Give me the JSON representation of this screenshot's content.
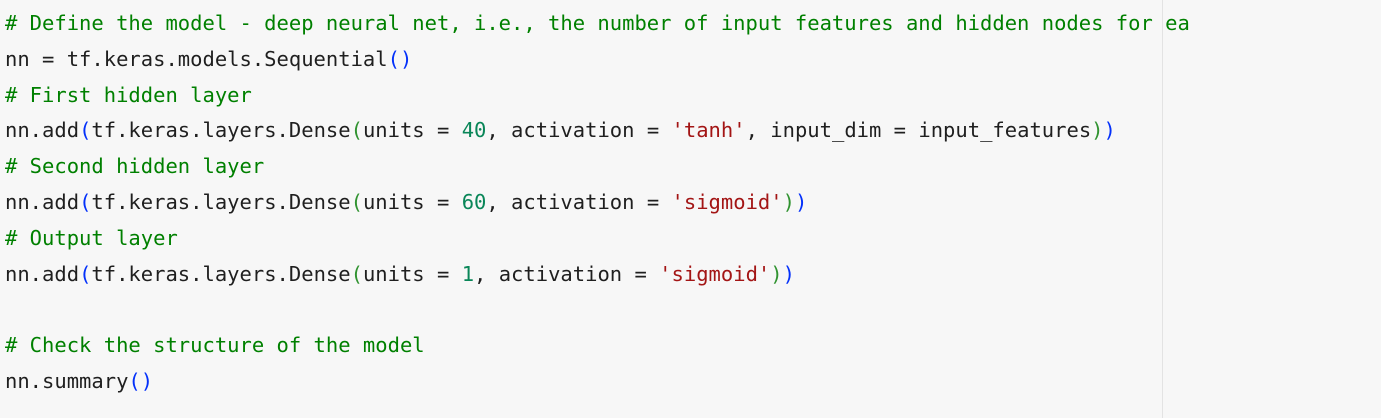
{
  "editor": {
    "language": "python",
    "colors": {
      "background": "#f7f7f7",
      "text": "#1f1f1f",
      "comment": "#008000",
      "number": "#098658",
      "string": "#a31515",
      "bracket_level_1": "#0431fa",
      "bracket_level_2": "#319331"
    },
    "lines": [
      [
        {
          "t": "# Define the model - deep neural net, i.e., the number of input features and hidden nodes for ea",
          "c": "comment"
        }
      ],
      [
        {
          "t": "nn = tf.keras.models.Sequential",
          "c": "plain"
        },
        {
          "t": "()",
          "c": "p1"
        }
      ],
      [
        {
          "t": "# First hidden layer",
          "c": "comment"
        }
      ],
      [
        {
          "t": "nn.add",
          "c": "plain"
        },
        {
          "t": "(",
          "c": "p1"
        },
        {
          "t": "tf.keras.layers.Dense",
          "c": "plain"
        },
        {
          "t": "(",
          "c": "p2"
        },
        {
          "t": "units = ",
          "c": "plain"
        },
        {
          "t": "40",
          "c": "num"
        },
        {
          "t": ", activation = ",
          "c": "plain"
        },
        {
          "t": "'tanh'",
          "c": "str"
        },
        {
          "t": ", input_dim = input_features",
          "c": "plain"
        },
        {
          "t": ")",
          "c": "p2"
        },
        {
          "t": ")",
          "c": "p1"
        }
      ],
      [
        {
          "t": "# Second hidden layer",
          "c": "comment"
        }
      ],
      [
        {
          "t": "nn.add",
          "c": "plain"
        },
        {
          "t": "(",
          "c": "p1"
        },
        {
          "t": "tf.keras.layers.Dense",
          "c": "plain"
        },
        {
          "t": "(",
          "c": "p2"
        },
        {
          "t": "units = ",
          "c": "plain"
        },
        {
          "t": "60",
          "c": "num"
        },
        {
          "t": ", activation = ",
          "c": "plain"
        },
        {
          "t": "'sigmoid'",
          "c": "str"
        },
        {
          "t": ")",
          "c": "p2"
        },
        {
          "t": ")",
          "c": "p1"
        }
      ],
      [
        {
          "t": "# Output layer",
          "c": "comment"
        }
      ],
      [
        {
          "t": "nn.add",
          "c": "plain"
        },
        {
          "t": "(",
          "c": "p1"
        },
        {
          "t": "tf.keras.layers.Dense",
          "c": "plain"
        },
        {
          "t": "(",
          "c": "p2"
        },
        {
          "t": "units = ",
          "c": "plain"
        },
        {
          "t": "1",
          "c": "num"
        },
        {
          "t": ", activation = ",
          "c": "plain"
        },
        {
          "t": "'sigmoid'",
          "c": "str"
        },
        {
          "t": ")",
          "c": "p2"
        },
        {
          "t": ")",
          "c": "p1"
        }
      ],
      [],
      [
        {
          "t": "# Check the structure of the model",
          "c": "comment"
        }
      ],
      [
        {
          "t": "nn.summary",
          "c": "plain"
        },
        {
          "t": "()",
          "c": "p1"
        }
      ]
    ]
  }
}
